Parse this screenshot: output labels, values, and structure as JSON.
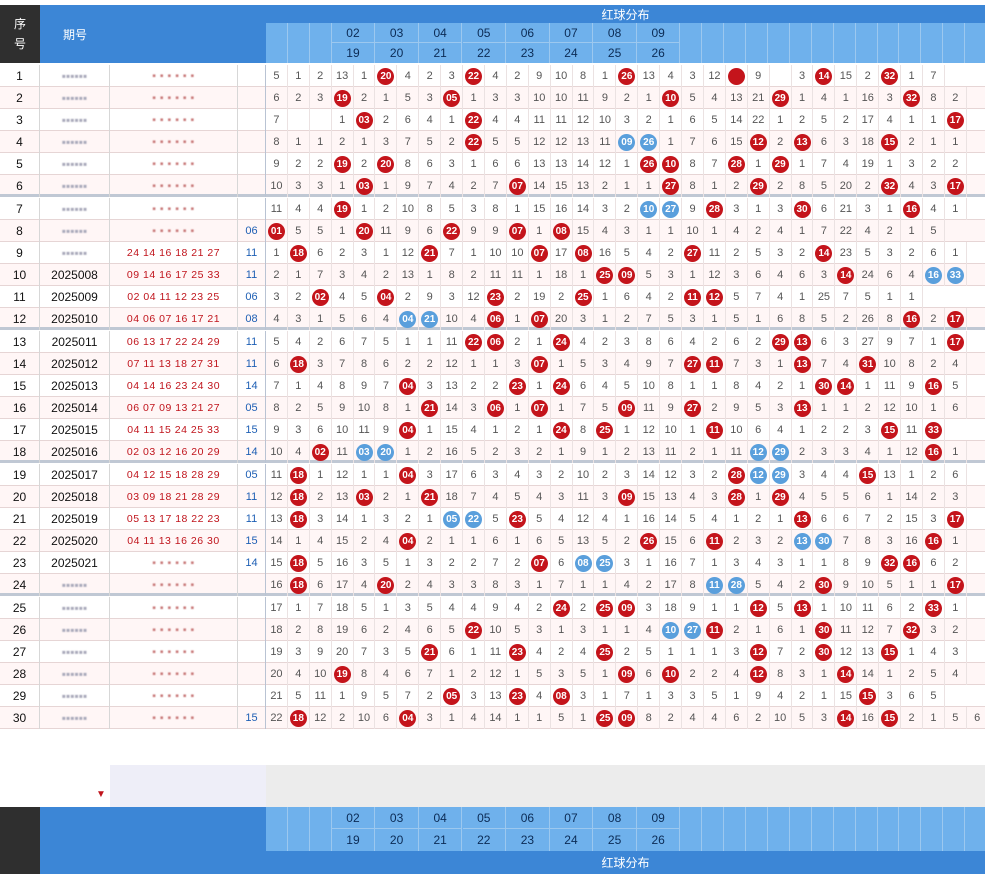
{
  "header": {
    "seq_label": "序号",
    "issue_label": "期号",
    "red_title": "红球分布",
    "top_numbers": [
      "02",
      "03",
      "04",
      "05",
      "06",
      "07",
      "08",
      "09"
    ],
    "bottom_numbers": [
      "19",
      "20",
      "21",
      "22",
      "23",
      "24",
      "25",
      "26"
    ]
  },
  "colors": {
    "red_ball": "#c4141b",
    "blue_ball": "#5a9fdc",
    "header_blue": "#3c86d6",
    "header_light": "#6fb1ec"
  },
  "rows": [
    {
      "seq": "1",
      "issue": "",
      "reds": "",
      "blue": "",
      "cells": [
        "5",
        "1",
        "2",
        "13",
        "1",
        "R20",
        "4",
        "2",
        "3",
        "R22",
        "4",
        "2",
        "9",
        "10",
        "8",
        "1",
        "R26",
        "13",
        "4",
        "3",
        "12",
        "R",
        "9",
        "",
        "3",
        "R14",
        "15",
        "2",
        "R32",
        "1",
        "7"
      ]
    },
    {
      "seq": "2",
      "issue": "",
      "reds": "",
      "blue": "",
      "cells": [
        "6",
        "2",
        "3",
        "R19",
        "2",
        "1",
        "5",
        "3",
        "R05",
        "1",
        "3",
        "3",
        "10",
        "10",
        "11",
        "9",
        "2",
        "1",
        "R10",
        "5",
        "4",
        "13",
        "21",
        "R29",
        "1",
        "4",
        "1",
        "16",
        "3",
        "R32",
        "8",
        "2"
      ]
    },
    {
      "seq": "3",
      "issue": "",
      "reds": "",
      "blue": "",
      "cells": [
        "7",
        "",
        "",
        "1",
        "R03",
        "2",
        "6",
        "4",
        "1",
        "R22",
        "4",
        "4",
        "11",
        "11",
        "12",
        "10",
        "3",
        "2",
        "1",
        "6",
        "5",
        "14",
        "22",
        "1",
        "2",
        "5",
        "2",
        "17",
        "4",
        "1",
        "1",
        "R17"
      ]
    },
    {
      "seq": "4",
      "issue": "",
      "reds": "",
      "blue": "",
      "cells": [
        "8",
        "1",
        "1",
        "2",
        "1",
        "3",
        "7",
        "5",
        "2",
        "R22",
        "5",
        "5",
        "12",
        "12",
        "13",
        "11",
        "B09",
        "B26",
        "1",
        "7",
        "6",
        "15",
        "R12",
        "2",
        "R13",
        "6",
        "3",
        "18",
        "R15",
        "2",
        "1",
        "1"
      ]
    },
    {
      "seq": "5",
      "issue": "",
      "reds": "",
      "blue": "",
      "cells": [
        "9",
        "2",
        "2",
        "R19",
        "2",
        "R20",
        "8",
        "6",
        "3",
        "1",
        "6",
        "6",
        "13",
        "13",
        "14",
        "12",
        "1",
        "R26",
        "R10",
        "8",
        "7",
        "R28",
        "1",
        "R29",
        "1",
        "7",
        "4",
        "19",
        "1",
        "3",
        "2",
        "2"
      ]
    },
    {
      "seq": "6",
      "issue": "",
      "reds": "",
      "blue": "",
      "cells": [
        "10",
        "3",
        "3",
        "1",
        "R03",
        "1",
        "9",
        "7",
        "4",
        "2",
        "7",
        "R07",
        "14",
        "15",
        "13",
        "2",
        "1",
        "1",
        "R27",
        "8",
        "1",
        "2",
        "R29",
        "2",
        "8",
        "5",
        "20",
        "2",
        "R32",
        "4",
        "3",
        "R17"
      ]
    },
    {
      "seq": "7",
      "issue": "",
      "reds": "",
      "blue": "",
      "cells": [
        "11",
        "4",
        "4",
        "R19",
        "1",
        "2",
        "10",
        "8",
        "5",
        "3",
        "8",
        "1",
        "15",
        "16",
        "14",
        "3",
        "2",
        "B10",
        "B27",
        "9",
        "R28",
        "3",
        "1",
        "3",
        "R30",
        "6",
        "21",
        "3",
        "1",
        "R16",
        "4",
        "1"
      ]
    },
    {
      "seq": "8",
      "issue": "",
      "reds": "",
      "blue": "06",
      "cells": [
        "R01",
        "5",
        "5",
        "1",
        "R20",
        "11",
        "9",
        "6",
        "R22",
        "9",
        "9",
        "R07",
        "1",
        "R08",
        "15",
        "4",
        "3",
        "1",
        "1",
        "10",
        "1",
        "4",
        "2",
        "4",
        "1",
        "7",
        "22",
        "4",
        "2",
        "1",
        "5"
      ]
    },
    {
      "seq": "9",
      "issue": "",
      "reds": "24 14 16 18 21 27",
      "blue": "11",
      "cells": [
        "1",
        "R18",
        "6",
        "2",
        "3",
        "1",
        "12",
        "R21",
        "7",
        "1",
        "10",
        "10",
        "R07",
        "17",
        "R08",
        "16",
        "5",
        "4",
        "2",
        "R27",
        "11",
        "2",
        "5",
        "3",
        "2",
        "R14",
        "23",
        "5",
        "3",
        "2",
        "6",
        "1"
      ]
    },
    {
      "seq": "10",
      "issue": "2025008",
      "reds": "09 14 16 17 25 33",
      "blue": "11",
      "cells": [
        "2",
        "1",
        "7",
        "3",
        "4",
        "2",
        "13",
        "1",
        "8",
        "2",
        "11",
        "11",
        "1",
        "18",
        "1",
        "R25",
        "R09",
        "5",
        "3",
        "1",
        "12",
        "3",
        "6",
        "4",
        "6",
        "3",
        "R14",
        "24",
        "6",
        "4",
        "B16",
        "B33"
      ]
    },
    {
      "seq": "11",
      "issue": "2025009",
      "reds": "02 04 11 12 23 25",
      "blue": "06",
      "cells": [
        "3",
        "2",
        "R02",
        "4",
        "5",
        "R04",
        "2",
        "9",
        "3",
        "12",
        "R23",
        "2",
        "19",
        "2",
        "R25",
        "1",
        "6",
        "4",
        "2",
        "R11",
        "R12",
        "5",
        "7",
        "4",
        "1",
        "25",
        "7",
        "5",
        "1",
        "1"
      ]
    },
    {
      "seq": "12",
      "issue": "2025010",
      "reds": "04 06 07 16 17 21",
      "blue": "08",
      "cells": [
        "4",
        "3",
        "1",
        "5",
        "6",
        "4",
        "B04",
        "B21",
        "10",
        "4",
        "R06",
        "1",
        "R07",
        "20",
        "3",
        "1",
        "2",
        "7",
        "5",
        "3",
        "1",
        "5",
        "1",
        "6",
        "8",
        "5",
        "2",
        "26",
        "8",
        "R16",
        "2",
        "R17"
      ]
    },
    {
      "seq": "13",
      "issue": "2025011",
      "reds": "06 13 17 22 24 29",
      "blue": "11",
      "cells": [
        "5",
        "4",
        "2",
        "6",
        "7",
        "5",
        "1",
        "1",
        "11",
        "R22",
        "R06",
        "2",
        "1",
        "R24",
        "4",
        "2",
        "3",
        "8",
        "6",
        "4",
        "2",
        "6",
        "2",
        "R29",
        "R13",
        "6",
        "3",
        "27",
        "9",
        "7",
        "1",
        "R17"
      ]
    },
    {
      "seq": "14",
      "issue": "2025012",
      "reds": "07 11 13 18 27 31",
      "blue": "11",
      "cells": [
        "6",
        "R18",
        "3",
        "7",
        "8",
        "6",
        "2",
        "2",
        "12",
        "1",
        "1",
        "3",
        "R07",
        "1",
        "5",
        "3",
        "4",
        "9",
        "7",
        "R27",
        "R11",
        "7",
        "3",
        "1",
        "R13",
        "7",
        "4",
        "R31",
        "10",
        "8",
        "2",
        "4"
      ]
    },
    {
      "seq": "15",
      "issue": "2025013",
      "reds": "04 14 16 23 24 30",
      "blue": "14",
      "cells": [
        "7",
        "1",
        "4",
        "8",
        "9",
        "7",
        "R04",
        "3",
        "13",
        "2",
        "2",
        "R23",
        "1",
        "R24",
        "6",
        "4",
        "5",
        "10",
        "8",
        "1",
        "1",
        "8",
        "4",
        "2",
        "1",
        "R30",
        "R14",
        "1",
        "11",
        "9",
        "R16",
        "5"
      ]
    },
    {
      "seq": "16",
      "issue": "2025014",
      "reds": "06 07 09 13 21 27",
      "blue": "05",
      "cells": [
        "8",
        "2",
        "5",
        "9",
        "10",
        "8",
        "1",
        "R21",
        "14",
        "3",
        "R06",
        "1",
        "R07",
        "1",
        "7",
        "5",
        "R09",
        "11",
        "9",
        "R27",
        "2",
        "9",
        "5",
        "3",
        "R13",
        "1",
        "1",
        "2",
        "12",
        "10",
        "1",
        "6"
      ]
    },
    {
      "seq": "17",
      "issue": "2025015",
      "reds": "04 11 15 24 25 33",
      "blue": "15",
      "cells": [
        "9",
        "3",
        "6",
        "10",
        "11",
        "9",
        "R04",
        "1",
        "15",
        "4",
        "1",
        "2",
        "1",
        "R24",
        "8",
        "R25",
        "1",
        "12",
        "10",
        "1",
        "R11",
        "10",
        "6",
        "4",
        "1",
        "2",
        "2",
        "3",
        "R15",
        "11",
        "R33"
      ]
    },
    {
      "seq": "18",
      "issue": "2025016",
      "reds": "02 03 12 16 20 29",
      "blue": "14",
      "cells": [
        "10",
        "4",
        "R02",
        "11",
        "B03",
        "B20",
        "1",
        "2",
        "16",
        "5",
        "2",
        "3",
        "2",
        "1",
        "9",
        "1",
        "2",
        "13",
        "11",
        "2",
        "1",
        "11",
        "B12",
        "B29",
        "2",
        "3",
        "3",
        "4",
        "1",
        "12",
        "R16",
        "1"
      ]
    },
    {
      "seq": "19",
      "issue": "2025017",
      "reds": "04 12 15 18 28 29",
      "blue": "05",
      "cells": [
        "11",
        "R18",
        "1",
        "12",
        "1",
        "1",
        "R04",
        "3",
        "17",
        "6",
        "3",
        "4",
        "3",
        "2",
        "10",
        "2",
        "3",
        "14",
        "12",
        "3",
        "2",
        "R28",
        "B12",
        "B29",
        "3",
        "4",
        "4",
        "R15",
        "13",
        "1",
        "2",
        "6"
      ]
    },
    {
      "seq": "20",
      "issue": "2025018",
      "reds": "03 09 18 21 28 29",
      "blue": "11",
      "cells": [
        "12",
        "R18",
        "2",
        "13",
        "R03",
        "2",
        "1",
        "R21",
        "18",
        "7",
        "4",
        "5",
        "4",
        "3",
        "11",
        "3",
        "R09",
        "15",
        "13",
        "4",
        "3",
        "R28",
        "1",
        "R29",
        "4",
        "5",
        "5",
        "6",
        "1",
        "14",
        "2",
        "3"
      ]
    },
    {
      "seq": "21",
      "issue": "2025019",
      "reds": "05 13 17 18 22 23",
      "blue": "11",
      "cells": [
        "13",
        "R18",
        "3",
        "14",
        "1",
        "3",
        "2",
        "1",
        "B05",
        "B22",
        "5",
        "R23",
        "5",
        "4",
        "12",
        "4",
        "1",
        "16",
        "14",
        "5",
        "4",
        "1",
        "2",
        "1",
        "R13",
        "6",
        "6",
        "7",
        "2",
        "15",
        "3",
        "R17"
      ]
    },
    {
      "seq": "22",
      "issue": "2025020",
      "reds": "04 11 13 16 26 30",
      "blue": "15",
      "cells": [
        "14",
        "1",
        "4",
        "15",
        "2",
        "4",
        "R04",
        "2",
        "1",
        "1",
        "6",
        "1",
        "6",
        "5",
        "13",
        "5",
        "2",
        "R26",
        "15",
        "6",
        "R11",
        "2",
        "3",
        "2",
        "B13",
        "B30",
        "7",
        "8",
        "3",
        "16",
        "R16",
        "1"
      ]
    },
    {
      "seq": "23",
      "issue": "2025021",
      "reds": "",
      "blue": "14",
      "cells": [
        "15",
        "R18",
        "5",
        "16",
        "3",
        "5",
        "1",
        "3",
        "2",
        "2",
        "7",
        "2",
        "R07",
        "6",
        "B08",
        "B25",
        "3",
        "1",
        "16",
        "7",
        "1",
        "3",
        "4",
        "3",
        "1",
        "1",
        "8",
        "9",
        "R32",
        "R16",
        "6",
        "2"
      ]
    },
    {
      "seq": "24",
      "issue": "",
      "reds": "",
      "blue": "",
      "cells": [
        "16",
        "R18",
        "6",
        "17",
        "4",
        "R20",
        "2",
        "4",
        "3",
        "3",
        "8",
        "3",
        "1",
        "7",
        "1",
        "1",
        "4",
        "2",
        "17",
        "8",
        "B11",
        "B28",
        "5",
        "4",
        "2",
        "R30",
        "9",
        "10",
        "5",
        "1",
        "1",
        "R17"
      ]
    },
    {
      "seq": "25",
      "issue": "",
      "reds": "",
      "blue": "",
      "cells": [
        "17",
        "1",
        "7",
        "18",
        "5",
        "1",
        "3",
        "5",
        "4",
        "4",
        "9",
        "4",
        "2",
        "R24",
        "2",
        "R25",
        "R09",
        "3",
        "18",
        "9",
        "1",
        "1",
        "R12",
        "5",
        "R13",
        "1",
        "10",
        "11",
        "6",
        "2",
        "R33",
        "1"
      ]
    },
    {
      "seq": "26",
      "issue": "",
      "reds": "",
      "blue": "",
      "cells": [
        "18",
        "2",
        "8",
        "19",
        "6",
        "2",
        "4",
        "6",
        "5",
        "R22",
        "10",
        "5",
        "3",
        "1",
        "3",
        "1",
        "1",
        "4",
        "B10",
        "B27",
        "R11",
        "2",
        "1",
        "6",
        "1",
        "R30",
        "11",
        "12",
        "7",
        "R32",
        "3",
        "2"
      ]
    },
    {
      "seq": "27",
      "issue": "",
      "reds": "",
      "blue": "",
      "cells": [
        "19",
        "3",
        "9",
        "20",
        "7",
        "3",
        "5",
        "R21",
        "6",
        "1",
        "11",
        "R23",
        "4",
        "2",
        "4",
        "R25",
        "2",
        "5",
        "1",
        "1",
        "1",
        "3",
        "R12",
        "7",
        "2",
        "R30",
        "12",
        "13",
        "R15",
        "1",
        "4",
        "3"
      ]
    },
    {
      "seq": "28",
      "issue": "",
      "reds": "",
      "blue": "",
      "cells": [
        "20",
        "4",
        "10",
        "R19",
        "8",
        "4",
        "6",
        "7",
        "1",
        "2",
        "12",
        "1",
        "5",
        "3",
        "5",
        "1",
        "R09",
        "6",
        "R10",
        "2",
        "2",
        "4",
        "R12",
        "8",
        "3",
        "1",
        "R14",
        "14",
        "1",
        "2",
        "5",
        "4"
      ]
    },
    {
      "seq": "29",
      "issue": "",
      "reds": "",
      "blue": "",
      "cells": [
        "21",
        "5",
        "11",
        "1",
        "9",
        "5",
        "7",
        "2",
        "R05",
        "3",
        "13",
        "R23",
        "4",
        "R08",
        "3",
        "1",
        "7",
        "1",
        "3",
        "3",
        "5",
        "1",
        "9",
        "4",
        "2",
        "1",
        "15",
        "R15",
        "3",
        "6",
        "5"
      ]
    },
    {
      "seq": "30",
      "issue": "",
      "reds": "",
      "blue": "15",
      "cells": [
        "22",
        "R18",
        "12",
        "2",
        "10",
        "6",
        "R04",
        "3",
        "1",
        "4",
        "14",
        "1",
        "1",
        "5",
        "1",
        "R25",
        "R09",
        "8",
        "2",
        "4",
        "4",
        "6",
        "2",
        "10",
        "5",
        "3",
        "R14",
        "16",
        "R15",
        "2",
        "1",
        "5",
        "6"
      ]
    }
  ],
  "footer": {
    "red_title": "红球分布",
    "top_numbers": [
      "02",
      "03",
      "04",
      "05",
      "06",
      "07",
      "08",
      "09"
    ],
    "bottom_numbers": [
      "19",
      "20",
      "21",
      "22",
      "23",
      "24",
      "25",
      "26"
    ]
  }
}
